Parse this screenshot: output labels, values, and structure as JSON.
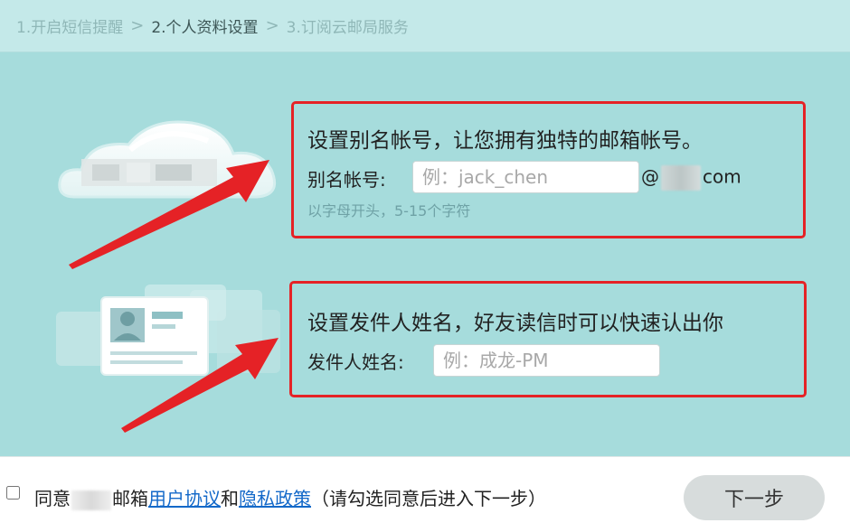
{
  "steps": [
    {
      "label": "1.开启短信提醒",
      "active": false
    },
    {
      "label": "2.个人资料设置",
      "active": true
    },
    {
      "label": "3.订阅云邮局服务",
      "active": false
    }
  ],
  "step_separator": ">",
  "alias": {
    "title": "设置别名帐号，让您拥有独特的邮箱帐号。",
    "label": "别名帐号:",
    "placeholder": "例：jack_chen",
    "at": "@",
    "domain_suffix": "com",
    "hint": "以字母开头，5-15个字符"
  },
  "sender": {
    "title": "设置发件人姓名，好友读信时可以快速认出你",
    "label": "发件人姓名:",
    "placeholder": "例：成龙-PM"
  },
  "footer": {
    "agree_prefix": "同意",
    "agree_mid": "邮箱",
    "user_agreement": "用户协议",
    "and": "和",
    "privacy_policy": "隐私政策",
    "agree_suffix": "（请勾选同意后进入下一步）",
    "next_label": "下一步"
  },
  "colors": {
    "highlight_box": "#e52226",
    "background": "#a6dcdc",
    "link": "#1469c9"
  }
}
